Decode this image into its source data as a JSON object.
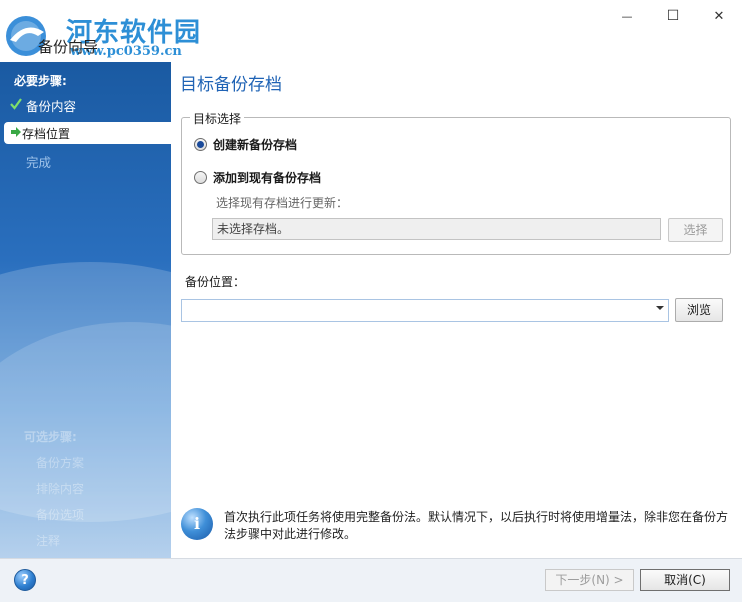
{
  "window": {
    "title": "备份向导",
    "watermark": {
      "site_name": "河东软件园",
      "url": "www.pc0359.cn"
    },
    "controls": {
      "minimize": "—",
      "maximize": "☐",
      "close": "✕"
    }
  },
  "sidebar": {
    "required_title": "必要步骤:",
    "steps": [
      {
        "label": "备份内容",
        "state": "done",
        "icon": "check-icon"
      },
      {
        "label": "存档位置",
        "state": "current",
        "icon": "arrow-icon"
      },
      {
        "label": "完成",
        "state": "pending"
      }
    ],
    "optional_title": "可选步骤:",
    "optional_steps": [
      "备份方案",
      "排除内容",
      "备份选项",
      "注释"
    ]
  },
  "main": {
    "heading": "目标备份存档",
    "target_group": {
      "legend": "目标选择",
      "options": [
        {
          "label": "创建新备份存档",
          "selected": true
        },
        {
          "label": "添加到现有备份存档",
          "selected": false
        }
      ],
      "select_hint": "选择现有存档进行更新：",
      "archive_value": "未选择存档。",
      "select_button": "选择"
    },
    "location": {
      "label": "备份位置：",
      "value": "",
      "browse_button": "浏览"
    },
    "info_text": "首次执行此项任务将使用完整备份法。默认情况下，以后执行时将使用增量法，除非您在备份方法步骤中对此进行修改。"
  },
  "footer": {
    "help": "?",
    "next_button": "下一步(N) >",
    "cancel_button": "取消(C)"
  },
  "colors": {
    "accent": "#1f63b5",
    "sidebar_top": "#1a5aa2",
    "sidebar_bottom": "#a9c9ea",
    "footer_bg": "#eef2f7"
  }
}
